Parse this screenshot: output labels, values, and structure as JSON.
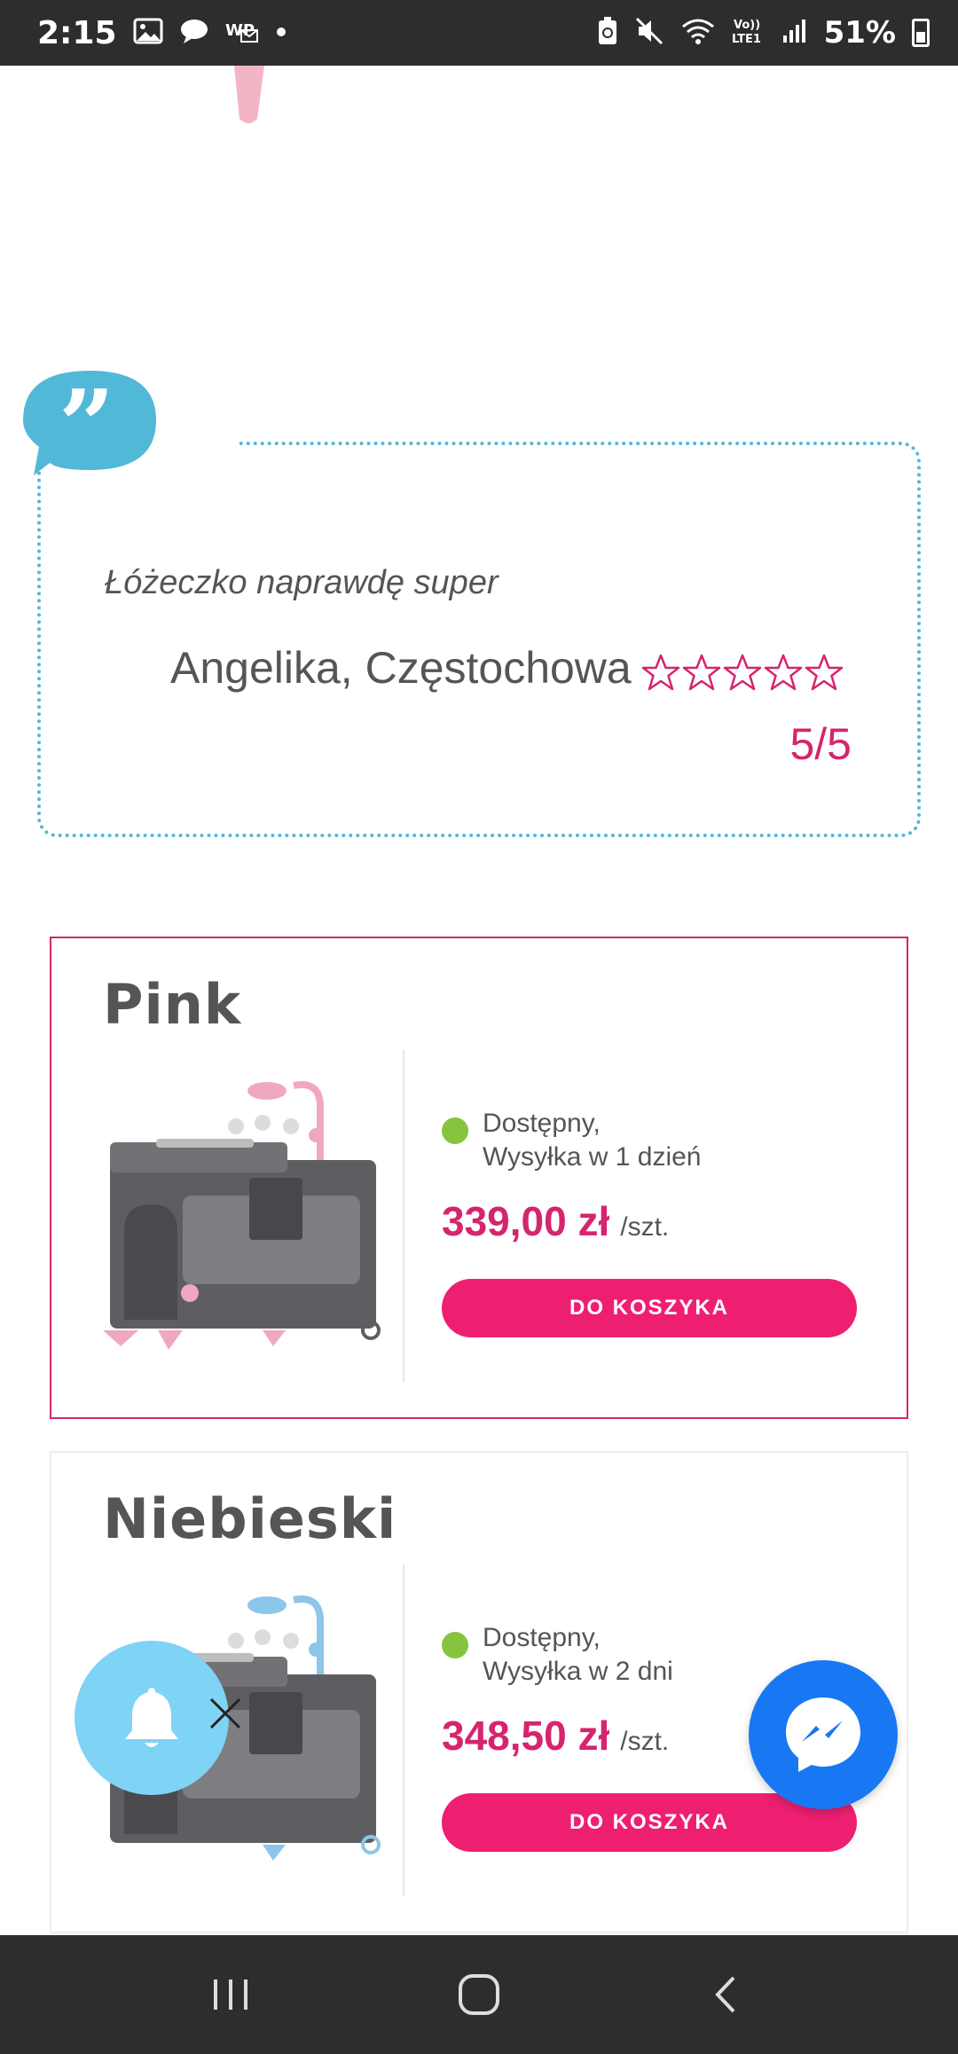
{
  "status_bar": {
    "time": "2:15",
    "battery_percent": "51%",
    "left_icons": [
      "gallery-icon",
      "chat-icon",
      "wp-mail-icon",
      "dot-icon"
    ],
    "right_icons": [
      "battery-saver-icon",
      "mute-icon",
      "wifi-icon",
      "volte-icon",
      "signal-icon",
      "battery-icon"
    ]
  },
  "review": {
    "text": "Łóżeczko naprawdę super",
    "author": "Angelika, Częstochowa",
    "rating_text": "5/5",
    "stars_total": 5,
    "star_color": "#d5256e"
  },
  "products": [
    {
      "title": "Pink",
      "availability_line1": "Dostępny,",
      "availability_line2": "Wysyłka w 1 dzień",
      "price": "339,00 zł",
      "unit": "/szt.",
      "cta": "DO KOSZYKA",
      "accent": "#f0a8c0"
    },
    {
      "title": "Niebieski",
      "availability_line1": "Dostępny,",
      "availability_line2": "Wysyłka w 2 dni",
      "price": "348,50 zł",
      "unit": "/szt.",
      "cta": "DO KOSZYKA",
      "accent": "#8cc6e8"
    }
  ],
  "colors": {
    "brand_pink": "#d5256e",
    "button_pink": "#ee1f70",
    "availability_green": "#86c440",
    "quote_blue": "#52b8d8",
    "bell_fab": "#7fd3f4",
    "messenger_blue": "#1877f2"
  },
  "nav_bar": {
    "buttons": [
      "recents-icon",
      "home-icon",
      "back-icon"
    ]
  }
}
